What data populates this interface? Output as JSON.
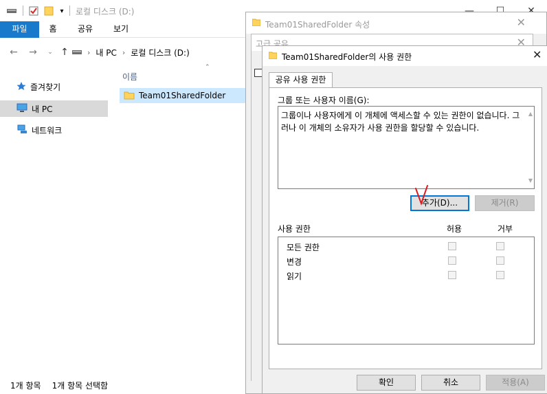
{
  "explorer": {
    "window_title": "로컬 디스크 (D:)",
    "ribbon_tabs": [
      "파일",
      "홈",
      "공유",
      "보기"
    ],
    "breadcrumb": [
      "내 PC",
      "로컬 디스크 (D:)"
    ],
    "column_header": "이름",
    "nav_items": [
      {
        "label": "즐겨찾기",
        "icon": "star-icon"
      },
      {
        "label": "내 PC",
        "icon": "computer-icon"
      },
      {
        "label": "네트워크",
        "icon": "network-icon"
      }
    ],
    "files": [
      {
        "name": "Team01SharedFolder"
      }
    ],
    "status": {
      "count": "1개 항목",
      "selected": "1개 항목 선택함"
    },
    "help": "?"
  },
  "properties": {
    "title": "Team01SharedFolder 속성",
    "advanced_title": "고급 공유"
  },
  "permissions": {
    "title": "Team01SharedFolder의 사용 권한",
    "tab_label": "공유 사용 권한",
    "group_label": "그룹 또는 사용자 이름(G):",
    "message": "그룹이나 사용자에게 이 개체에 액세스할 수 있는 권한이 없습니다. 그러나 이 개체의 소유자가 사용 권한을 할당할 수 있습니다.",
    "add_button": "추가(D)...",
    "remove_button": "제거(R)",
    "perm_header": "사용 권한",
    "allow_header": "허용",
    "deny_header": "거부",
    "perm_rows": [
      {
        "name": "모든 권한"
      },
      {
        "name": "변경"
      },
      {
        "name": "읽기"
      }
    ],
    "ok_button": "확인",
    "cancel_button": "취소",
    "apply_button": "적용(A)"
  },
  "colors": {
    "accent": "#1979ca",
    "selection": "#cce8ff",
    "folder": "#ffd35c",
    "annotation": "#e0191f"
  }
}
